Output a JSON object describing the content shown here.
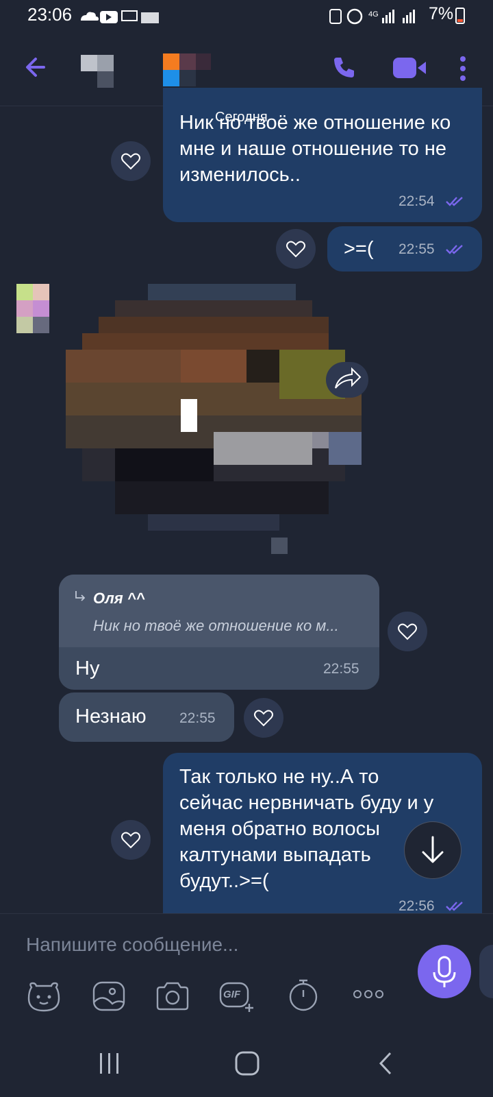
{
  "status_bar": {
    "time": "23:06",
    "network": "4G",
    "battery": "7%"
  },
  "header": {
    "back_icon": "arrow-left-icon",
    "call_icon": "phone-icon",
    "video_icon": "video-camera-icon",
    "menu_icon": "more-vert-icon",
    "accent": "#7b67ee"
  },
  "chat": {
    "date_label": "Сегодня",
    "messages": [
      {
        "direction": "out",
        "text": "Ник но твоё же отношение ко мне и наше отношение то не изменилось..",
        "time": "22:54",
        "status": "read"
      },
      {
        "direction": "out",
        "text": ">=(",
        "time": "22:55",
        "status": "read"
      },
      {
        "direction": "in",
        "type": "sticker"
      },
      {
        "direction": "in",
        "reply_to": {
          "author": "Оля ^^",
          "snippet": "Ник но твоё же отношение ко м..."
        },
        "text": "Ну",
        "time": "22:55"
      },
      {
        "direction": "in",
        "text": "Незнаю",
        "time": "22:55"
      },
      {
        "direction": "out",
        "text_lines": [
          "Так только не ну..А то",
          "сейчас нервничать буду и у",
          "меня обратно волосы",
          "калтунами выпадать",
          "будут..>=("
        ],
        "time": "22:56",
        "status": "read"
      }
    ]
  },
  "composer": {
    "placeholder": "Напишите сообщение...",
    "gif_label": "GIF",
    "tools": [
      "sticker-icon",
      "gallery-icon",
      "camera-icon",
      "gif-icon",
      "timer-icon",
      "more-horiz-icon"
    ],
    "mic_color": "#7b67ee"
  },
  "nav_bar": [
    "recent-apps-icon",
    "home-icon",
    "back-icon"
  ]
}
